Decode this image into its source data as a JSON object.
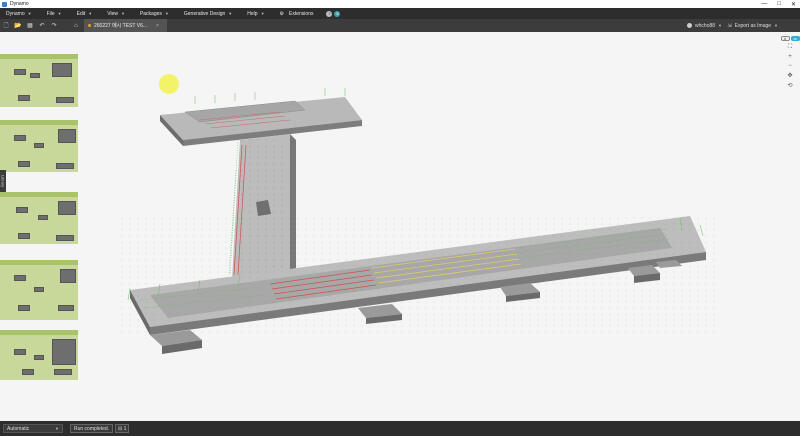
{
  "window": {
    "title": "Dynamo",
    "minimize": "—",
    "maximize": "□",
    "close": "✕"
  },
  "menu": {
    "items": [
      "Dynamo",
      "File",
      "Edit",
      "View",
      "Packages",
      "Generative Design",
      "Help"
    ],
    "extensions_label": "Extensions",
    "help_glyph": "?",
    "badge_count": "5"
  },
  "toolbar": {
    "tab_title": "260227 메시 TEST V6...",
    "tab_close": "×",
    "user_name": "whcho88",
    "export_label": "Export as Image"
  },
  "canvas": {
    "library_label": "Library",
    "background_preview_toggle": "3D"
  },
  "statusbar": {
    "run_mode": "Automatic",
    "run_status": "Run completed.",
    "run_count": "⊟ 1"
  },
  "colors": {
    "menubar": "#2d2d2d",
    "toolbar": "#3c3c3c",
    "group": "#c8d79a",
    "group_header": "#a9c36a",
    "light": "#f3f36a"
  },
  "icons": [
    "new-file-icon",
    "open-file-icon",
    "save-file-icon",
    "undo-icon",
    "redo-icon",
    "home-icon",
    "avatar-icon",
    "export-icon",
    "zoom-fit-icon",
    "zoom-in-icon",
    "zoom-out-icon",
    "pan-icon",
    "orbit-icon"
  ]
}
